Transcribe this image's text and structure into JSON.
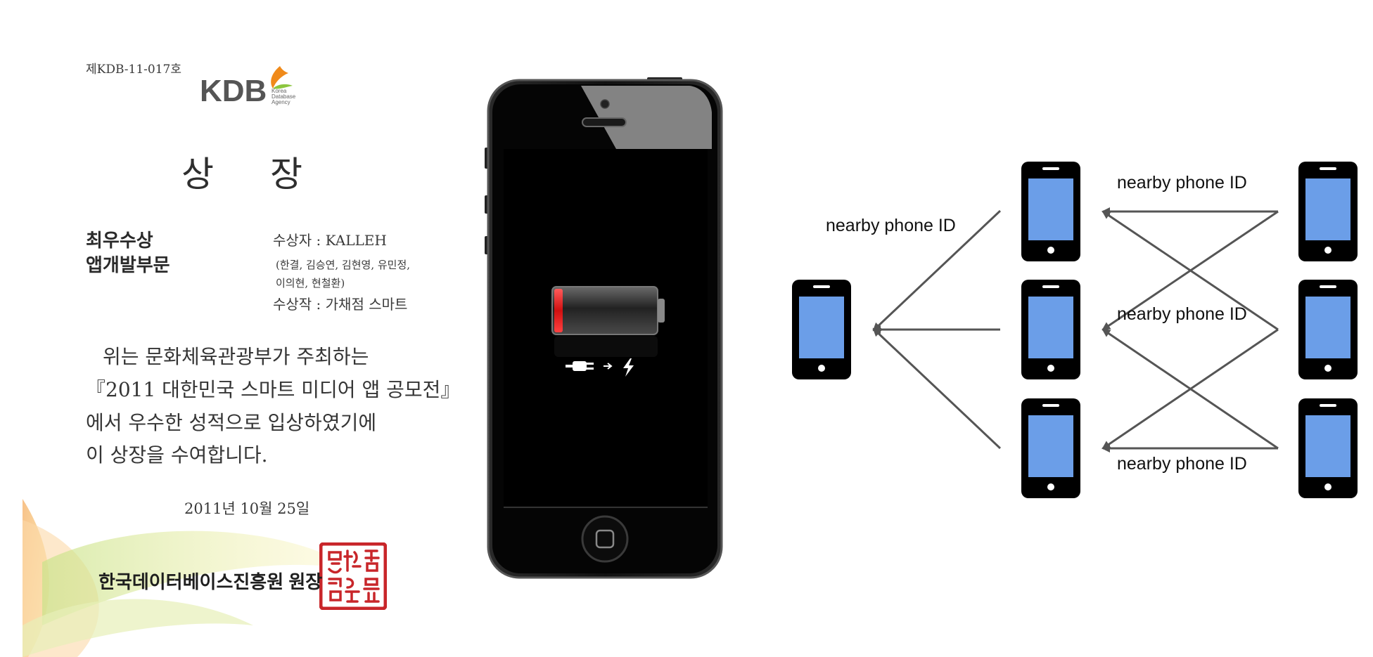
{
  "certificate": {
    "number": "제KDB-11-017호",
    "logo_text": "KDB",
    "logo_subtext": [
      "Korea",
      "Database",
      "Agency"
    ],
    "title_part1": "상",
    "title_part2": "장",
    "award_line1": "최우수상",
    "award_line2": "앱개발부문",
    "recipient": "수상자 : KALLEH",
    "members_line1": "(한결, 김승연, 김현영, 유민정,",
    "members_line2": "이의현, 현철환)",
    "work": "수상작 : 가채점 스마트",
    "body_line1": "위는 문화체육관광부가 주최하는",
    "body_line2": "『2011 대한민국 스마트 미디어 앱 공모전』",
    "body_line3": "에서 우수한 성적으로 입상하였기에",
    "body_line4": "이 상장을 수여합니다.",
    "date": "2011년  10월  25일",
    "issuer": "한국데이터베이스진흥원 원장",
    "seal_color": "#c8262a"
  },
  "phone": {
    "screen_state": "battery-low-charging",
    "battery_icon": "battery-empty-icon",
    "charging_icons": [
      "plug-icon",
      "arrow-right-icon",
      "lightning-icon"
    ],
    "battery_level_color": "#e01b1b"
  },
  "diagram": {
    "phone_screen_color": "#6b9ee8",
    "edge_color": "#555555",
    "labels": {
      "center_left": "nearby phone ID",
      "top": "nearby phone ID",
      "middle": "nearby phone ID",
      "bottom": "nearby phone ID"
    }
  }
}
